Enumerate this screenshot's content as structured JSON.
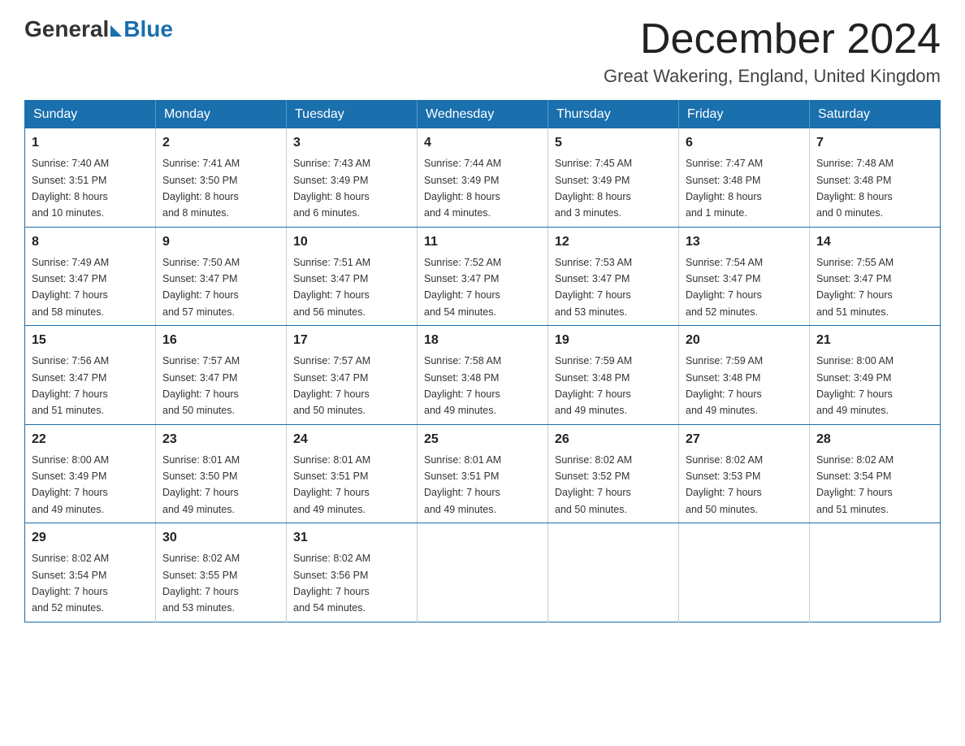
{
  "logo": {
    "general": "General",
    "blue": "Blue",
    "triangle": "▶"
  },
  "header": {
    "title": "December 2024",
    "subtitle": "Great Wakering, England, United Kingdom"
  },
  "days_of_week": [
    "Sunday",
    "Monday",
    "Tuesday",
    "Wednesday",
    "Thursday",
    "Friday",
    "Saturday"
  ],
  "weeks": [
    [
      {
        "day": "1",
        "info": "Sunrise: 7:40 AM\nSunset: 3:51 PM\nDaylight: 8 hours\nand 10 minutes."
      },
      {
        "day": "2",
        "info": "Sunrise: 7:41 AM\nSunset: 3:50 PM\nDaylight: 8 hours\nand 8 minutes."
      },
      {
        "day": "3",
        "info": "Sunrise: 7:43 AM\nSunset: 3:49 PM\nDaylight: 8 hours\nand 6 minutes."
      },
      {
        "day": "4",
        "info": "Sunrise: 7:44 AM\nSunset: 3:49 PM\nDaylight: 8 hours\nand 4 minutes."
      },
      {
        "day": "5",
        "info": "Sunrise: 7:45 AM\nSunset: 3:49 PM\nDaylight: 8 hours\nand 3 minutes."
      },
      {
        "day": "6",
        "info": "Sunrise: 7:47 AM\nSunset: 3:48 PM\nDaylight: 8 hours\nand 1 minute."
      },
      {
        "day": "7",
        "info": "Sunrise: 7:48 AM\nSunset: 3:48 PM\nDaylight: 8 hours\nand 0 minutes."
      }
    ],
    [
      {
        "day": "8",
        "info": "Sunrise: 7:49 AM\nSunset: 3:47 PM\nDaylight: 7 hours\nand 58 minutes."
      },
      {
        "day": "9",
        "info": "Sunrise: 7:50 AM\nSunset: 3:47 PM\nDaylight: 7 hours\nand 57 minutes."
      },
      {
        "day": "10",
        "info": "Sunrise: 7:51 AM\nSunset: 3:47 PM\nDaylight: 7 hours\nand 56 minutes."
      },
      {
        "day": "11",
        "info": "Sunrise: 7:52 AM\nSunset: 3:47 PM\nDaylight: 7 hours\nand 54 minutes."
      },
      {
        "day": "12",
        "info": "Sunrise: 7:53 AM\nSunset: 3:47 PM\nDaylight: 7 hours\nand 53 minutes."
      },
      {
        "day": "13",
        "info": "Sunrise: 7:54 AM\nSunset: 3:47 PM\nDaylight: 7 hours\nand 52 minutes."
      },
      {
        "day": "14",
        "info": "Sunrise: 7:55 AM\nSunset: 3:47 PM\nDaylight: 7 hours\nand 51 minutes."
      }
    ],
    [
      {
        "day": "15",
        "info": "Sunrise: 7:56 AM\nSunset: 3:47 PM\nDaylight: 7 hours\nand 51 minutes."
      },
      {
        "day": "16",
        "info": "Sunrise: 7:57 AM\nSunset: 3:47 PM\nDaylight: 7 hours\nand 50 minutes."
      },
      {
        "day": "17",
        "info": "Sunrise: 7:57 AM\nSunset: 3:47 PM\nDaylight: 7 hours\nand 50 minutes."
      },
      {
        "day": "18",
        "info": "Sunrise: 7:58 AM\nSunset: 3:48 PM\nDaylight: 7 hours\nand 49 minutes."
      },
      {
        "day": "19",
        "info": "Sunrise: 7:59 AM\nSunset: 3:48 PM\nDaylight: 7 hours\nand 49 minutes."
      },
      {
        "day": "20",
        "info": "Sunrise: 7:59 AM\nSunset: 3:48 PM\nDaylight: 7 hours\nand 49 minutes."
      },
      {
        "day": "21",
        "info": "Sunrise: 8:00 AM\nSunset: 3:49 PM\nDaylight: 7 hours\nand 49 minutes."
      }
    ],
    [
      {
        "day": "22",
        "info": "Sunrise: 8:00 AM\nSunset: 3:49 PM\nDaylight: 7 hours\nand 49 minutes."
      },
      {
        "day": "23",
        "info": "Sunrise: 8:01 AM\nSunset: 3:50 PM\nDaylight: 7 hours\nand 49 minutes."
      },
      {
        "day": "24",
        "info": "Sunrise: 8:01 AM\nSunset: 3:51 PM\nDaylight: 7 hours\nand 49 minutes."
      },
      {
        "day": "25",
        "info": "Sunrise: 8:01 AM\nSunset: 3:51 PM\nDaylight: 7 hours\nand 49 minutes."
      },
      {
        "day": "26",
        "info": "Sunrise: 8:02 AM\nSunset: 3:52 PM\nDaylight: 7 hours\nand 50 minutes."
      },
      {
        "day": "27",
        "info": "Sunrise: 8:02 AM\nSunset: 3:53 PM\nDaylight: 7 hours\nand 50 minutes."
      },
      {
        "day": "28",
        "info": "Sunrise: 8:02 AM\nSunset: 3:54 PM\nDaylight: 7 hours\nand 51 minutes."
      }
    ],
    [
      {
        "day": "29",
        "info": "Sunrise: 8:02 AM\nSunset: 3:54 PM\nDaylight: 7 hours\nand 52 minutes."
      },
      {
        "day": "30",
        "info": "Sunrise: 8:02 AM\nSunset: 3:55 PM\nDaylight: 7 hours\nand 53 minutes."
      },
      {
        "day": "31",
        "info": "Sunrise: 8:02 AM\nSunset: 3:56 PM\nDaylight: 7 hours\nand 54 minutes."
      },
      null,
      null,
      null,
      null
    ]
  ]
}
